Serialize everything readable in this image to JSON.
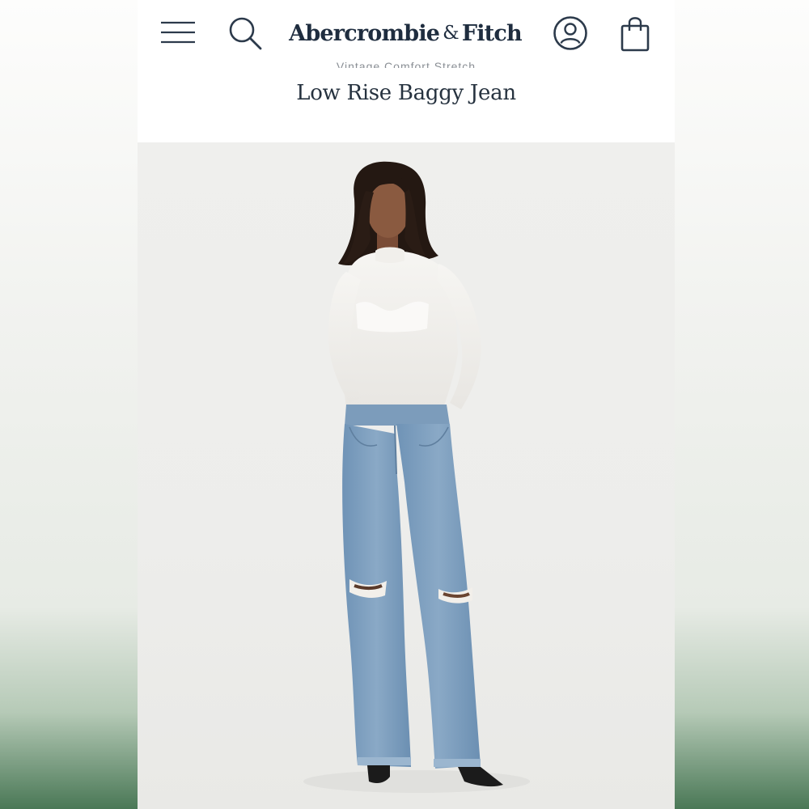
{
  "header": {
    "brand_left": "Abercrombie",
    "brand_amp": "&",
    "brand_right": "Fitch",
    "icons": {
      "menu": "hamburger-menu-icon",
      "search": "search-icon",
      "account": "user-account-icon",
      "bag": "shopping-bag-icon"
    }
  },
  "product": {
    "collection": "Vintage Comfort Stretch",
    "title": "Low Rise Baggy Jean"
  },
  "image": {
    "description_icon": "product-photo"
  },
  "colors": {
    "brand_navy": "#1f2d3f",
    "denim": "#7b9dbd",
    "background_green": "#4f7a5a"
  }
}
